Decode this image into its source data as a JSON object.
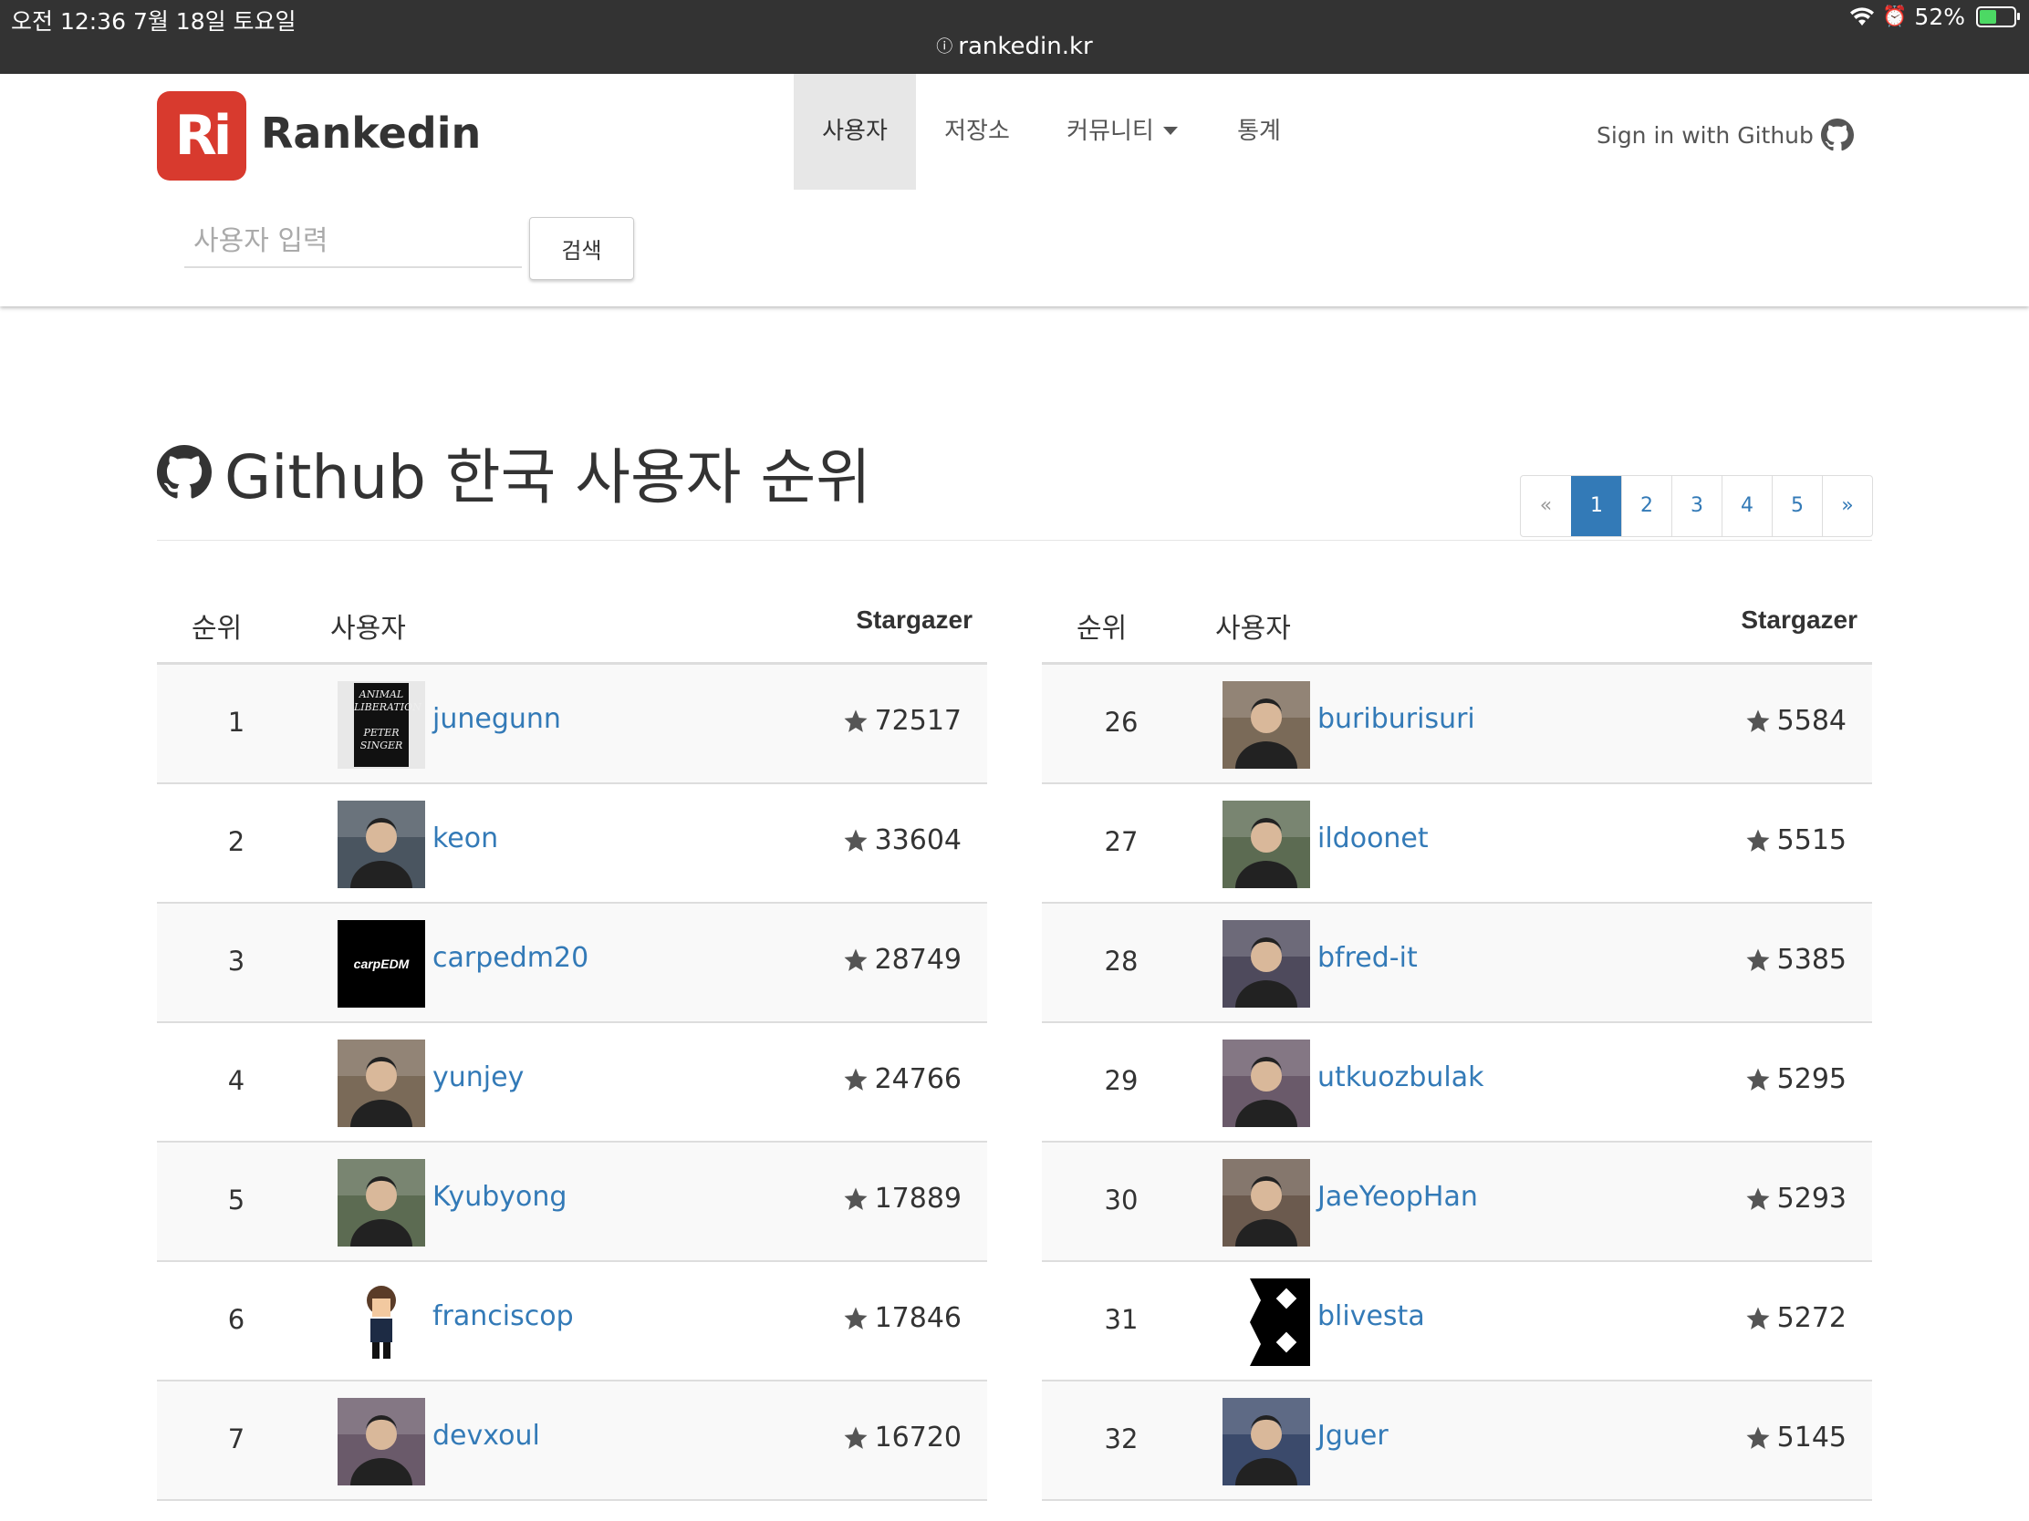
{
  "status_bar": {
    "time": "오전 12:36   7월 18일 토요일",
    "url": "rankedin.kr",
    "battery": "52%",
    "battery_level": 0.52
  },
  "navbar": {
    "logo_mark": "Ri",
    "brand": "Rankedin",
    "items": [
      {
        "label": "사용자",
        "active": true
      },
      {
        "label": "저장소",
        "active": false
      },
      {
        "label": "커뮤니티",
        "active": false,
        "dropdown": true
      },
      {
        "label": "통계",
        "active": false
      }
    ],
    "signin": "Sign in with Github"
  },
  "search": {
    "placeholder": "사용자 입력",
    "button": "검색"
  },
  "page": {
    "title": "Github 한국 사용자 순위"
  },
  "pagination": [
    "«",
    "1",
    "2",
    "3",
    "4",
    "5",
    "»"
  ],
  "table_headers": {
    "rank": "순위",
    "user": "사용자",
    "stars": "Stargazer"
  },
  "left_rows": [
    {
      "rank": "1",
      "user": "junegunn",
      "stars": "72517",
      "avatar": "book-cover"
    },
    {
      "rank": "2",
      "user": "keon",
      "stars": "33604",
      "avatar": "photo"
    },
    {
      "rank": "3",
      "user": "carpedm20",
      "stars": "28749",
      "avatar": "carpEDM"
    },
    {
      "rank": "4",
      "user": "yunjey",
      "stars": "24766",
      "avatar": "photo"
    },
    {
      "rank": "5",
      "user": "Kyubyong",
      "stars": "17889",
      "avatar": "photo"
    },
    {
      "rank": "6",
      "user": "franciscop",
      "stars": "17846",
      "avatar": "pixel"
    },
    {
      "rank": "7",
      "user": "devxoul",
      "stars": "16720",
      "avatar": "photo"
    }
  ],
  "right_rows": [
    {
      "rank": "26",
      "user": "buriburisuri",
      "stars": "5584",
      "avatar": "photo"
    },
    {
      "rank": "27",
      "user": "ildoonet",
      "stars": "5515",
      "avatar": "photo"
    },
    {
      "rank": "28",
      "user": "bfred-it",
      "stars": "5385",
      "avatar": "photo"
    },
    {
      "rank": "29",
      "user": "utkuozbulak",
      "stars": "5295",
      "avatar": "photo"
    },
    {
      "rank": "30",
      "user": "JaeYeopHan",
      "stars": "5293",
      "avatar": "photo"
    },
    {
      "rank": "31",
      "user": "blivesta",
      "stars": "5272",
      "avatar": "logo"
    },
    {
      "rank": "32",
      "user": "Jguer",
      "stars": "5145",
      "avatar": "photo"
    }
  ],
  "colors": {
    "link": "#337ab7",
    "brand": "#d83a2e",
    "statusbar": "#333333"
  }
}
